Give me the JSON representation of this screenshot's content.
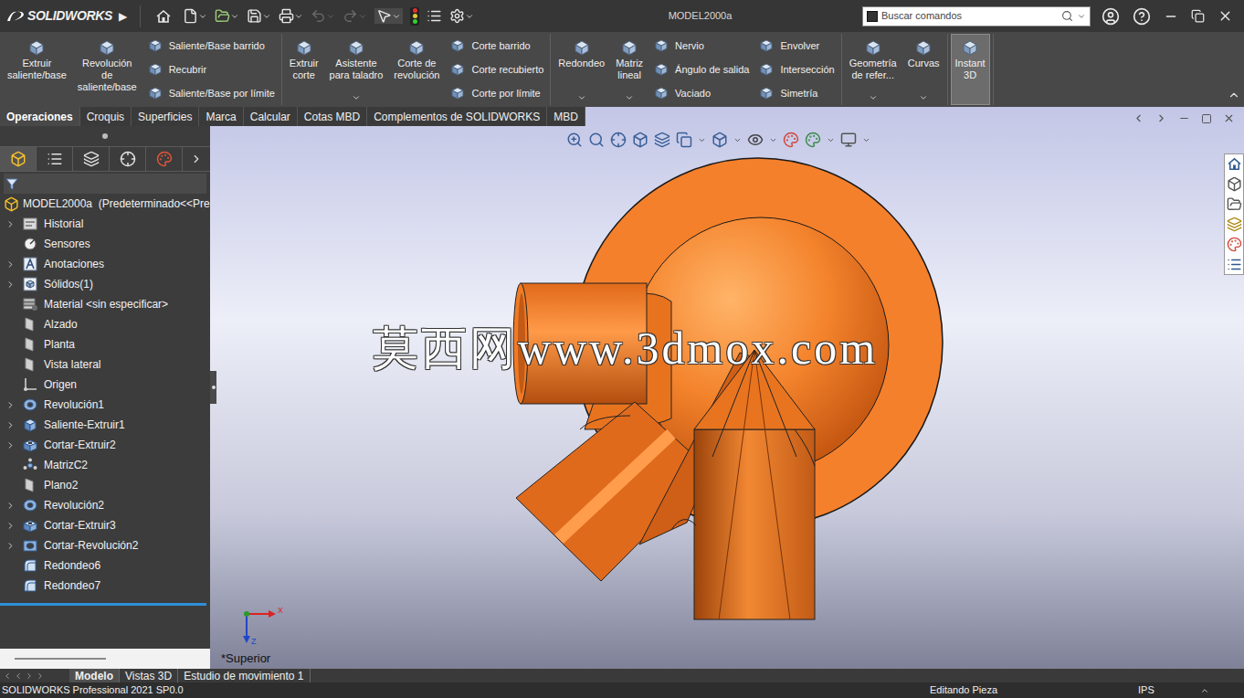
{
  "titleBar": {
    "brand": "SOLIDWORKS",
    "menuArrow": "▶",
    "title": "MODEL2000a",
    "search": {
      "placeholder": "Buscar comandos"
    },
    "undoDisabled": true,
    "redoDisabled": true
  },
  "ribbon": {
    "groups": [
      [
        {
          "kind": "big",
          "lines": [
            "Extruir",
            "saliente/base"
          ],
          "dropdown": false,
          "active": false
        },
        {
          "kind": "big",
          "lines": [
            "Revolución",
            "de",
            "saliente/base"
          ],
          "dropdown": false,
          "active": false
        },
        {
          "kind": "column",
          "items": [
            "Saliente/Base barrido",
            "Recubrir",
            "Saliente/Base por límite"
          ]
        }
      ],
      [
        {
          "kind": "big",
          "lines": [
            "Extruir",
            "corte"
          ],
          "dropdown": false,
          "active": false
        },
        {
          "kind": "big",
          "lines": [
            "Asistente",
            "para taladro"
          ],
          "dropdown": true,
          "active": false
        },
        {
          "kind": "big",
          "lines": [
            "Corte de",
            "revolución"
          ],
          "dropdown": false,
          "active": false
        },
        {
          "kind": "column",
          "items": [
            "Corte barrido",
            "Corte recubierto",
            "Corte por límite"
          ]
        }
      ],
      [
        {
          "kind": "big",
          "lines": [
            "Redondeo"
          ],
          "dropdown": true,
          "active": false
        },
        {
          "kind": "big",
          "lines": [
            "Matriz",
            "lineal"
          ],
          "dropdown": true,
          "active": false
        },
        {
          "kind": "column",
          "items": [
            "Nervio",
            "Ángulo de salida",
            "Vaciado"
          ]
        },
        {
          "kind": "column",
          "items": [
            "Envolver",
            "Intersección",
            "Simetría"
          ]
        }
      ],
      [
        {
          "kind": "big",
          "lines": [
            "Geometría",
            "de refer..."
          ],
          "dropdown": true,
          "active": false
        },
        {
          "kind": "big",
          "lines": [
            "Curvas"
          ],
          "dropdown": true,
          "active": false
        }
      ],
      [
        {
          "kind": "big",
          "lines": [
            "Instant",
            "3D"
          ],
          "dropdown": false,
          "active": true
        }
      ]
    ]
  },
  "commandTabs": [
    {
      "label": "Operaciones",
      "selected": true
    },
    {
      "label": "Croquis",
      "selected": false
    },
    {
      "label": "Superficies",
      "selected": false
    },
    {
      "label": "Marca",
      "selected": false
    },
    {
      "label": "Calcular",
      "selected": false
    },
    {
      "label": "Cotas MBD",
      "selected": false
    },
    {
      "label": "Complementos de SOLIDWORKS",
      "selected": false
    },
    {
      "label": "MBD",
      "selected": false
    }
  ],
  "featureTree": {
    "root": "MODEL2000a  (Predeterminado<<Pre",
    "items": [
      {
        "label": "Historial",
        "kind": "folder",
        "expandable": true
      },
      {
        "label": "Sensores",
        "kind": "sensor",
        "expandable": false
      },
      {
        "label": "Anotaciones",
        "kind": "annotation",
        "expandable": true
      },
      {
        "label": "Sólidos(1)",
        "kind": "solid",
        "expandable": true
      },
      {
        "label": "Material <sin especificar>",
        "kind": "material",
        "expandable": false
      },
      {
        "label": "Alzado",
        "kind": "plane",
        "expandable": false
      },
      {
        "label": "Planta",
        "kind": "plane",
        "expandable": false
      },
      {
        "label": "Vista lateral",
        "kind": "plane",
        "expandable": false
      },
      {
        "label": "Origen",
        "kind": "origin",
        "expandable": false
      },
      {
        "label": "Revolución1",
        "kind": "revolve",
        "expandable": true
      },
      {
        "label": "Saliente-Extruir1",
        "kind": "extrude",
        "expandable": true
      },
      {
        "label": "Cortar-Extruir2",
        "kind": "cut",
        "expandable": true
      },
      {
        "label": "MatrizC2",
        "kind": "pattern",
        "expandable": false
      },
      {
        "label": "Plano2",
        "kind": "plane",
        "expandable": false
      },
      {
        "label": "Revolución2",
        "kind": "revolve",
        "expandable": true
      },
      {
        "label": "Cortar-Extruir3",
        "kind": "cut",
        "expandable": true
      },
      {
        "label": "Cortar-Revolución2",
        "kind": "cutrevolve",
        "expandable": true
      },
      {
        "label": "Redondeo6",
        "kind": "fillet",
        "expandable": false
      },
      {
        "label": "Redondeo7",
        "kind": "fillet",
        "expandable": false
      }
    ]
  },
  "viewport": {
    "watermark": "莫西网www.3dmox.com",
    "view": "*Superior",
    "triad": {
      "x": "X",
      "z": "Z"
    }
  },
  "bottomTabs": [
    {
      "label": "Modelo",
      "selected": true
    },
    {
      "label": "Vistas 3D",
      "selected": false
    },
    {
      "label": "Estudio de movimiento 1",
      "selected": false
    }
  ],
  "statusBar": {
    "product": "SOLIDWORKS Professional 2021 SP0.0",
    "mode": "Editando Pieza",
    "units": "IPS"
  }
}
